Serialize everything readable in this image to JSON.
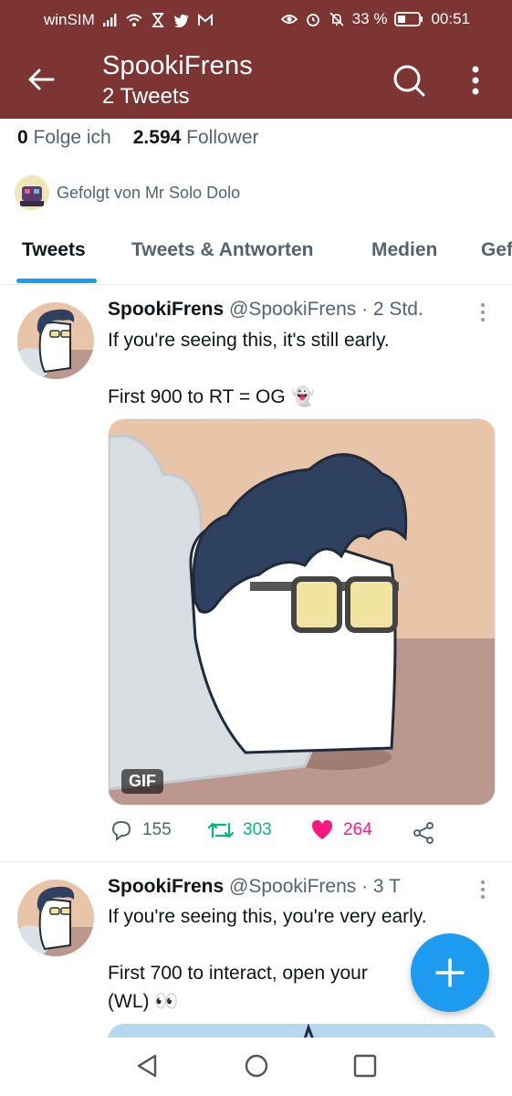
{
  "status": {
    "carrier": "winSIM",
    "battery": "33 %",
    "time": "00:51"
  },
  "header": {
    "title": "SpookiFrens",
    "subtitle": "2 Tweets"
  },
  "profile": {
    "following_count": "0",
    "following_label": "Folge ich",
    "followers_count": "2.594",
    "followers_label": "Follower",
    "followed_by": "Gefolgt von Mr Solo Dolo"
  },
  "tabs": [
    {
      "label": "Tweets"
    },
    {
      "label": "Tweets & Antworten"
    },
    {
      "label": "Medien"
    },
    {
      "label": "Gef"
    }
  ],
  "tweets": [
    {
      "name": "SpookiFrens",
      "meta": "@SpookiFrens · 2 Std.",
      "text": "If you're seeing this, it's still early.\n\nFirst 900 to RT = OG 👻",
      "media_badge": "GIF",
      "replies": "155",
      "retweets": "303",
      "likes": "264"
    },
    {
      "name": "SpookiFrens",
      "meta": "@SpookiFrens · 3 T",
      "text": "If you're seeing this, you're very early.\n\nFirst 700 to interact, open your\n(WL) 👀"
    }
  ],
  "colors": {
    "header": "#7c3533",
    "accent": "#1d9bf0",
    "retweet": "#00ba7c",
    "like": "#f91880"
  }
}
